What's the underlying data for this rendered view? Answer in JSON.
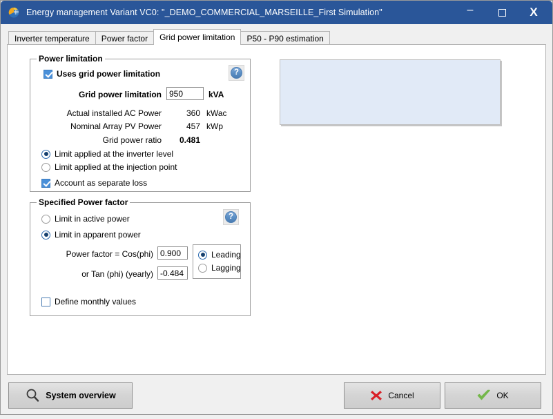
{
  "window": {
    "title": "Energy management Variant VC0:  \"_DEMO_COMMERCIAL_MARSEILLE_First Simulation\"",
    "icon": "pvsyst-pie-icon",
    "controls": {
      "minimize": "–",
      "maximize": "maximize-square",
      "close": "X"
    }
  },
  "tabs": [
    {
      "label": "Inverter temperature",
      "active": false
    },
    {
      "label": "Power factor",
      "active": false
    },
    {
      "label": "Grid power limitation",
      "active": true
    },
    {
      "label": "P50 - P90 estimation",
      "active": false
    }
  ],
  "power_limitation": {
    "group_title": "Power limitation",
    "help_label": "?",
    "uses_grid_power_limitation": {
      "label": "Uses grid power limitation",
      "checked": true
    },
    "grid_power_limitation": {
      "label": "Grid power limitation",
      "value": "950",
      "unit": "kVA"
    },
    "actual_installed_ac_power": {
      "label": "Actual installed AC Power",
      "value": "360",
      "unit": "kWac"
    },
    "nominal_array_pv_power": {
      "label": "Nominal Array PV Power",
      "value": "457",
      "unit": "kWp"
    },
    "grid_power_ratio": {
      "label": "Grid power ratio",
      "value": "0.481"
    },
    "limit_inverter": {
      "label": "Limit applied at the inverter level",
      "selected": true
    },
    "limit_injection": {
      "label": "Limit applied at the injection point",
      "selected": false
    },
    "account_separate_loss": {
      "label": "Account as separate loss",
      "checked": true
    }
  },
  "power_factor": {
    "group_title": "Specified Power factor",
    "help_label": "?",
    "limit_active": {
      "label": "Limit in active power",
      "selected": false
    },
    "limit_apparent": {
      "label": "Limit in apparent power",
      "selected": true
    },
    "cos_phi": {
      "label": "Power factor = Cos(phi)",
      "value": "0.900"
    },
    "tan_phi": {
      "label": "or Tan (phi) (yearly)",
      "value": "-0.484"
    },
    "leading": {
      "label": "Leading",
      "selected": true
    },
    "lagging": {
      "label": "Lagging",
      "selected": false
    },
    "define_monthly": {
      "label": "Define monthly values",
      "checked": false
    }
  },
  "buttons": {
    "system_overview": "System overview",
    "cancel": "Cancel",
    "ok": "OK"
  },
  "colors": {
    "titlebar": "#2a5699",
    "accent": "#4a90d9",
    "preview_panel": "#e1eaf7",
    "cancel_icon": "#d91f26",
    "ok_icon": "#74b74a"
  }
}
